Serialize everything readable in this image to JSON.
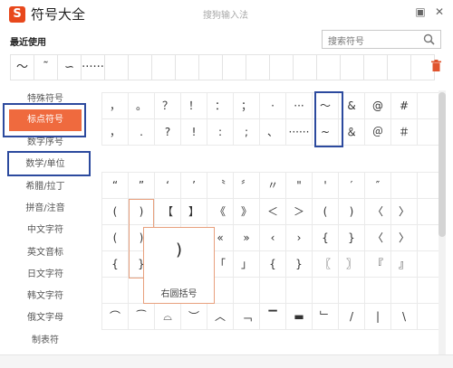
{
  "app": {
    "title": "符号大全",
    "window_subtitle": "搜狗输入法",
    "logo_letter": "S"
  },
  "window": {
    "pin_glyph": "▣",
    "close_glyph": "✕"
  },
  "recent": {
    "title": "最近使用",
    "items": [
      "～",
      "˜",
      "∽",
      "······",
      "",
      "",
      "",
      "",
      "",
      "",
      "",
      "",
      "",
      "",
      "",
      "",
      "",
      ""
    ]
  },
  "search": {
    "placeholder": "搜索符号"
  },
  "sidebar": {
    "items": [
      {
        "label": "特殊符号"
      },
      {
        "label": "标点符号",
        "active": true
      },
      {
        "label": "数字序号"
      },
      {
        "label": "数学/单位"
      },
      {
        "label": "希腊/拉丁"
      },
      {
        "label": "拼音/注音"
      },
      {
        "label": "中文字符"
      },
      {
        "label": "英文音标"
      },
      {
        "label": "日文字符"
      },
      {
        "label": "韩文字符"
      },
      {
        "label": "俄文字母"
      },
      {
        "label": "制表符"
      }
    ]
  },
  "grid1": [
    "，",
    "。",
    "？",
    "！",
    "：",
    "；",
    "·",
    "···",
    "～",
    "&",
    "@",
    "#",
    "",
    "，",
    ".",
    "?",
    "!",
    ":",
    ";",
    "、",
    "······",
    "~",
    "＆",
    "＠",
    "＃",
    ""
  ],
  "grid2": [
    "“",
    "”",
    "‘",
    "’",
    "〝",
    "〞",
    "〃",
    "\"",
    "'",
    "′",
    "″",
    "",
    "",
    "(",
    ")",
    "【",
    "】",
    "《",
    "》",
    "＜",
    "＞",
    "(",
    ")",
    "〈",
    "〉",
    "",
    "(",
    ")",
    "",
    "",
    "«",
    "»",
    "‹",
    "›",
    "{",
    "}",
    "〈",
    "〉",
    "",
    "{",
    "}",
    "",
    "",
    "「",
    "」",
    "{",
    "}",
    "〖",
    "〗",
    "『",
    "』",
    "",
    "",
    "",
    "",
    "",
    "",
    "",
    "",
    "",
    "",
    "",
    "",
    "",
    "",
    "⌒",
    "⁀",
    "⌓",
    "︶",
    "︿",
    "﹁",
    "▔",
    "▬",
    "﹂",
    "/",
    "|",
    "\\",
    ""
  ],
  "popup": {
    "symbol": ")",
    "name": "右圆括号"
  }
}
